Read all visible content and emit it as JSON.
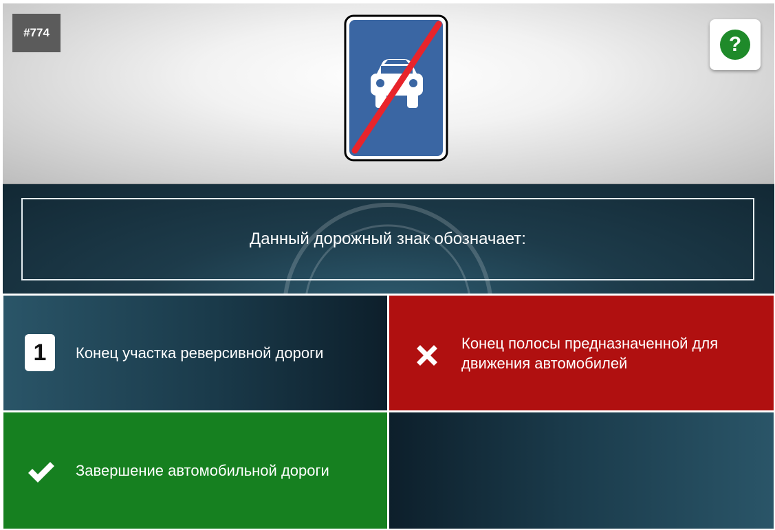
{
  "question_number": "#774",
  "help_label": "?",
  "question_text": "Данный дорожный знак обозначает:",
  "answers": [
    {
      "badge": "1",
      "text": "Конец участка реверсивной дороги",
      "state": "neutral"
    },
    {
      "badge": "",
      "text": "Конец полосы предназначенной для движения автомобилей",
      "state": "wrong"
    },
    {
      "badge": "",
      "text": "Завершение автомобильной дороги",
      "state": "correct"
    },
    {
      "badge": "",
      "text": "",
      "state": "empty"
    }
  ],
  "colors": {
    "wrong": "#b01010",
    "correct": "#168020",
    "sign_blue": "#3a66a3",
    "strike_red": "#e8242b"
  },
  "icons": {
    "sign": "end-of-road-for-cars-sign",
    "help": "question-mark-icon",
    "wrong": "cross-icon",
    "correct": "checkmark-icon"
  }
}
